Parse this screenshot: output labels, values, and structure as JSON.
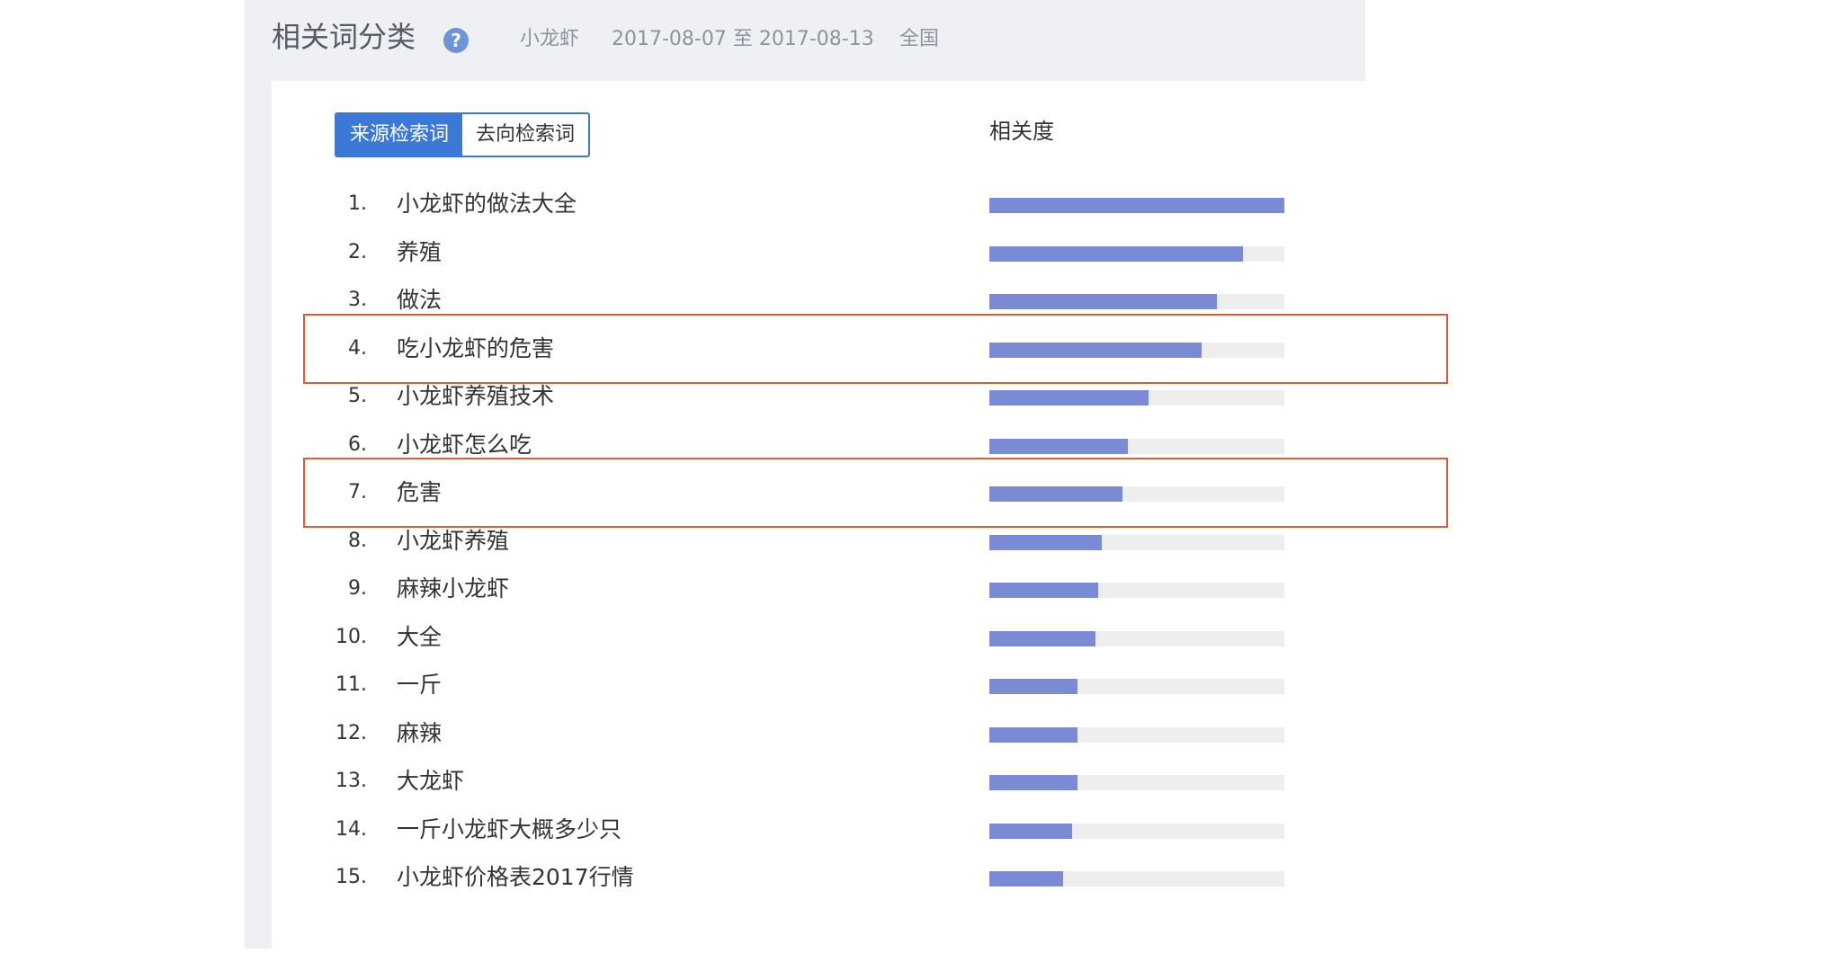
{
  "header": {
    "title": "相关词分类",
    "keyword": "小龙虾",
    "date_range": "2017-08-07 至 2017-08-13",
    "region": "全国"
  },
  "tabs": [
    {
      "label": "来源检索词",
      "active": true
    },
    {
      "label": "去向检索词",
      "active": false
    }
  ],
  "relevance_header": "相关度",
  "colors": {
    "bar_fill": "#7b8ad4",
    "bar_track": "#eeeeee",
    "accent": "#3c79d6",
    "highlight": "#e05a34"
  },
  "rows": [
    {
      "rank": "1.",
      "term": "小龙虾的做法大全",
      "relevance": 1.0
    },
    {
      "rank": "2.",
      "term": "养殖",
      "relevance": 0.86
    },
    {
      "rank": "3.",
      "term": "做法",
      "relevance": 0.77
    },
    {
      "rank": "4.",
      "term": "吃小龙虾的危害",
      "relevance": 0.72
    },
    {
      "rank": "5.",
      "term": "小龙虾养殖技术",
      "relevance": 0.54
    },
    {
      "rank": "6.",
      "term": "小龙虾怎么吃",
      "relevance": 0.47
    },
    {
      "rank": "7.",
      "term": "危害",
      "relevance": 0.45
    },
    {
      "rank": "8.",
      "term": "小龙虾养殖",
      "relevance": 0.38
    },
    {
      "rank": "9.",
      "term": "麻辣小龙虾",
      "relevance": 0.37
    },
    {
      "rank": "10.",
      "term": "大全",
      "relevance": 0.36
    },
    {
      "rank": "11.",
      "term": "一斤",
      "relevance": 0.3
    },
    {
      "rank": "12.",
      "term": "麻辣",
      "relevance": 0.3
    },
    {
      "rank": "13.",
      "term": "大龙虾",
      "relevance": 0.3
    },
    {
      "rank": "14.",
      "term": "一斤小龙虾大概多少只",
      "relevance": 0.28
    },
    {
      "rank": "15.",
      "term": "小龙虾价格表2017行情",
      "relevance": 0.25
    }
  ],
  "highlighted_ranks": [
    "4.",
    "7."
  ]
}
